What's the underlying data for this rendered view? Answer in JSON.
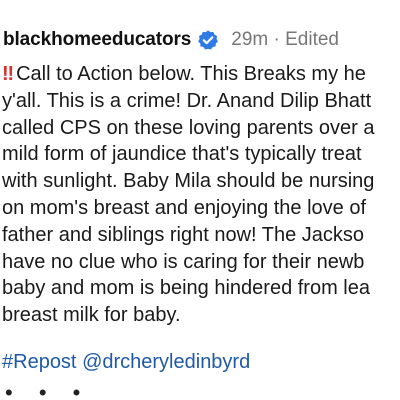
{
  "post": {
    "username": "blackhomeeducators",
    "time": "29m",
    "separator": "·",
    "edited": "Edited",
    "verified_icon": "verified-badge-icon",
    "alert_icon": "double-exclamation-icon",
    "alert_glyph": "‼",
    "alert_color": "#d8302c",
    "lines": [
      "Call to Action below. This Breaks my he",
      "y'all. This is a crime! Dr. Anand Dilip Bhatt",
      "called CPS on these loving parents over a",
      "mild form of jaundice that's typically treat",
      "with sunlight. Baby Mila should be nursing",
      "on mom's breast and enjoying the love of",
      "father and siblings right now! The Jackso",
      "have no clue who is caring for their newb",
      "baby and mom is being hindered from lea",
      "breast milk for baby."
    ],
    "hashtag": "#Repost",
    "mention": "@drcheryledinbyrd",
    "more_label": "• • •",
    "link_color": "#1f5aa8"
  }
}
